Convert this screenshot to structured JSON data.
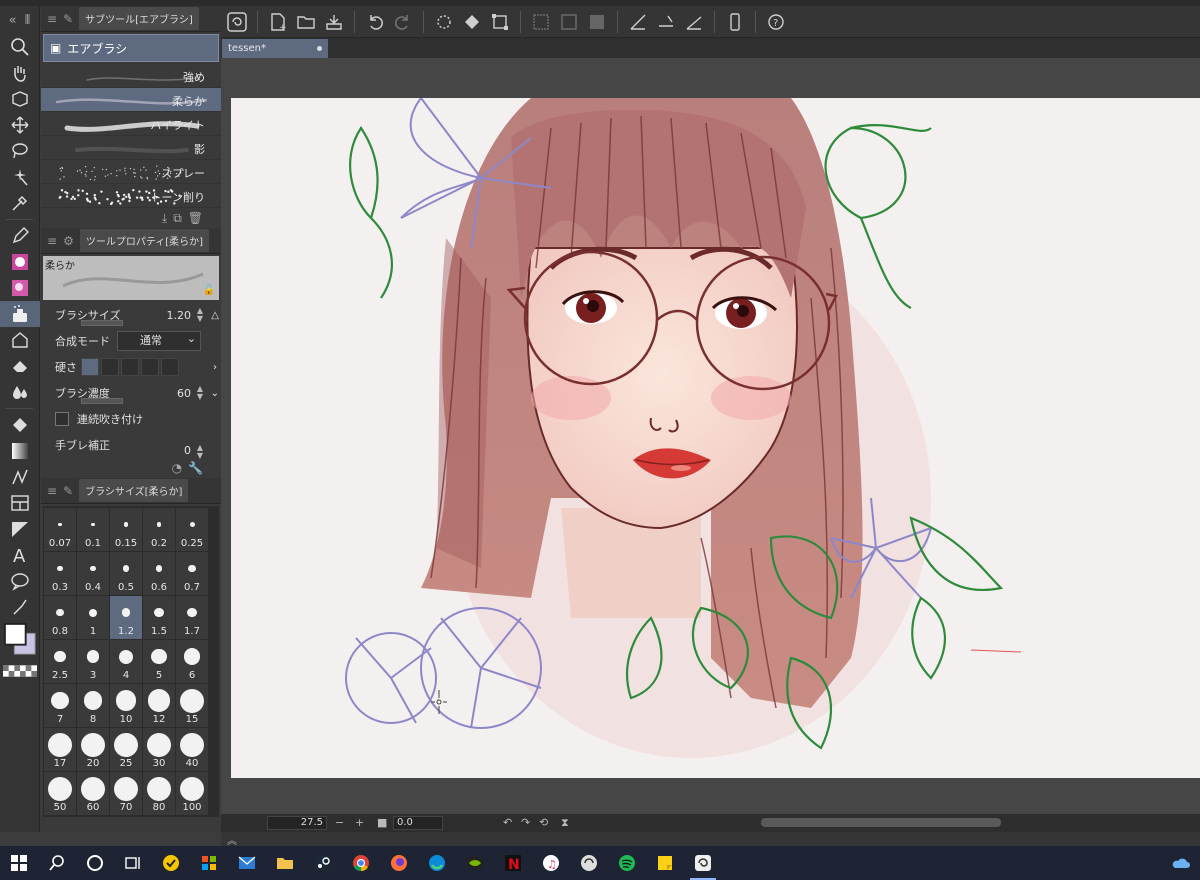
{
  "document": {
    "tab_title": "tessen*"
  },
  "panels": {
    "subtool": {
      "tab_label": "サブツール[エアブラシ]",
      "group_label": "エアブラシ",
      "brushes": [
        {
          "label": "強め",
          "active": false
        },
        {
          "label": "柔らか",
          "active": true
        },
        {
          "label": "ハイライト",
          "active": false
        },
        {
          "label": "影",
          "active": false
        },
        {
          "label": "スプレー",
          "active": false
        },
        {
          "label": "トーン削り",
          "active": false
        }
      ]
    },
    "tool_property": {
      "tab_label": "ツールプロパティ[柔らか]",
      "preview_label": "柔らか",
      "brush_size_label": "ブラシサイズ",
      "brush_size_value": "1.20",
      "blend_mode_label": "合成モード",
      "blend_mode_value": "通常",
      "hardness_label": "硬さ",
      "brush_density_label": "ブラシ濃度",
      "brush_density_value": "60",
      "continuous_spray_label": "連続吹き付け",
      "stabilization_label": "手ブレ補正",
      "stabilization_value": "0"
    },
    "brush_size": {
      "tab_label": "ブラシサイズ[柔らか]",
      "sizes": [
        "0.07",
        "0.1",
        "0.15",
        "0.2",
        "0.25",
        "0.3",
        "0.4",
        "0.5",
        "0.6",
        "0.7",
        "0.8",
        "1",
        "1.2",
        "1.5",
        "1.7",
        "2.5",
        "3",
        "4",
        "5",
        "6",
        "7",
        "8",
        "10",
        "12",
        "15",
        "17",
        "20",
        "25",
        "30",
        "40",
        "50",
        "60",
        "70",
        "80",
        "100"
      ],
      "selected": "1.2"
    }
  },
  "statusbar": {
    "zoom": "27.5",
    "rotation": "0.0"
  },
  "colors": {
    "accent": "#5d6a80",
    "panel_bg": "#3a3a3a",
    "canvas_bg": "#f5f0f0",
    "hair": "#b56a6a",
    "line": "#6b2a2a",
    "leaf": "#2e8b3a",
    "flower": "#8d87c9"
  },
  "taskbar": {
    "icons": [
      "windows-start-icon",
      "search-icon",
      "cortana-icon",
      "task-view-icon",
      "norton-icon",
      "store-icon",
      "mail-icon",
      "file-explorer-icon",
      "steam-icon",
      "chrome-icon",
      "firefox-icon",
      "edge-icon",
      "nvidia-icon",
      "netflix-icon",
      "itunes-icon",
      "clip-studio-icon",
      "spotify-icon",
      "sticky-notes-icon",
      "clip-studio-paint-icon"
    ],
    "active": "clip-studio-paint-icon"
  }
}
